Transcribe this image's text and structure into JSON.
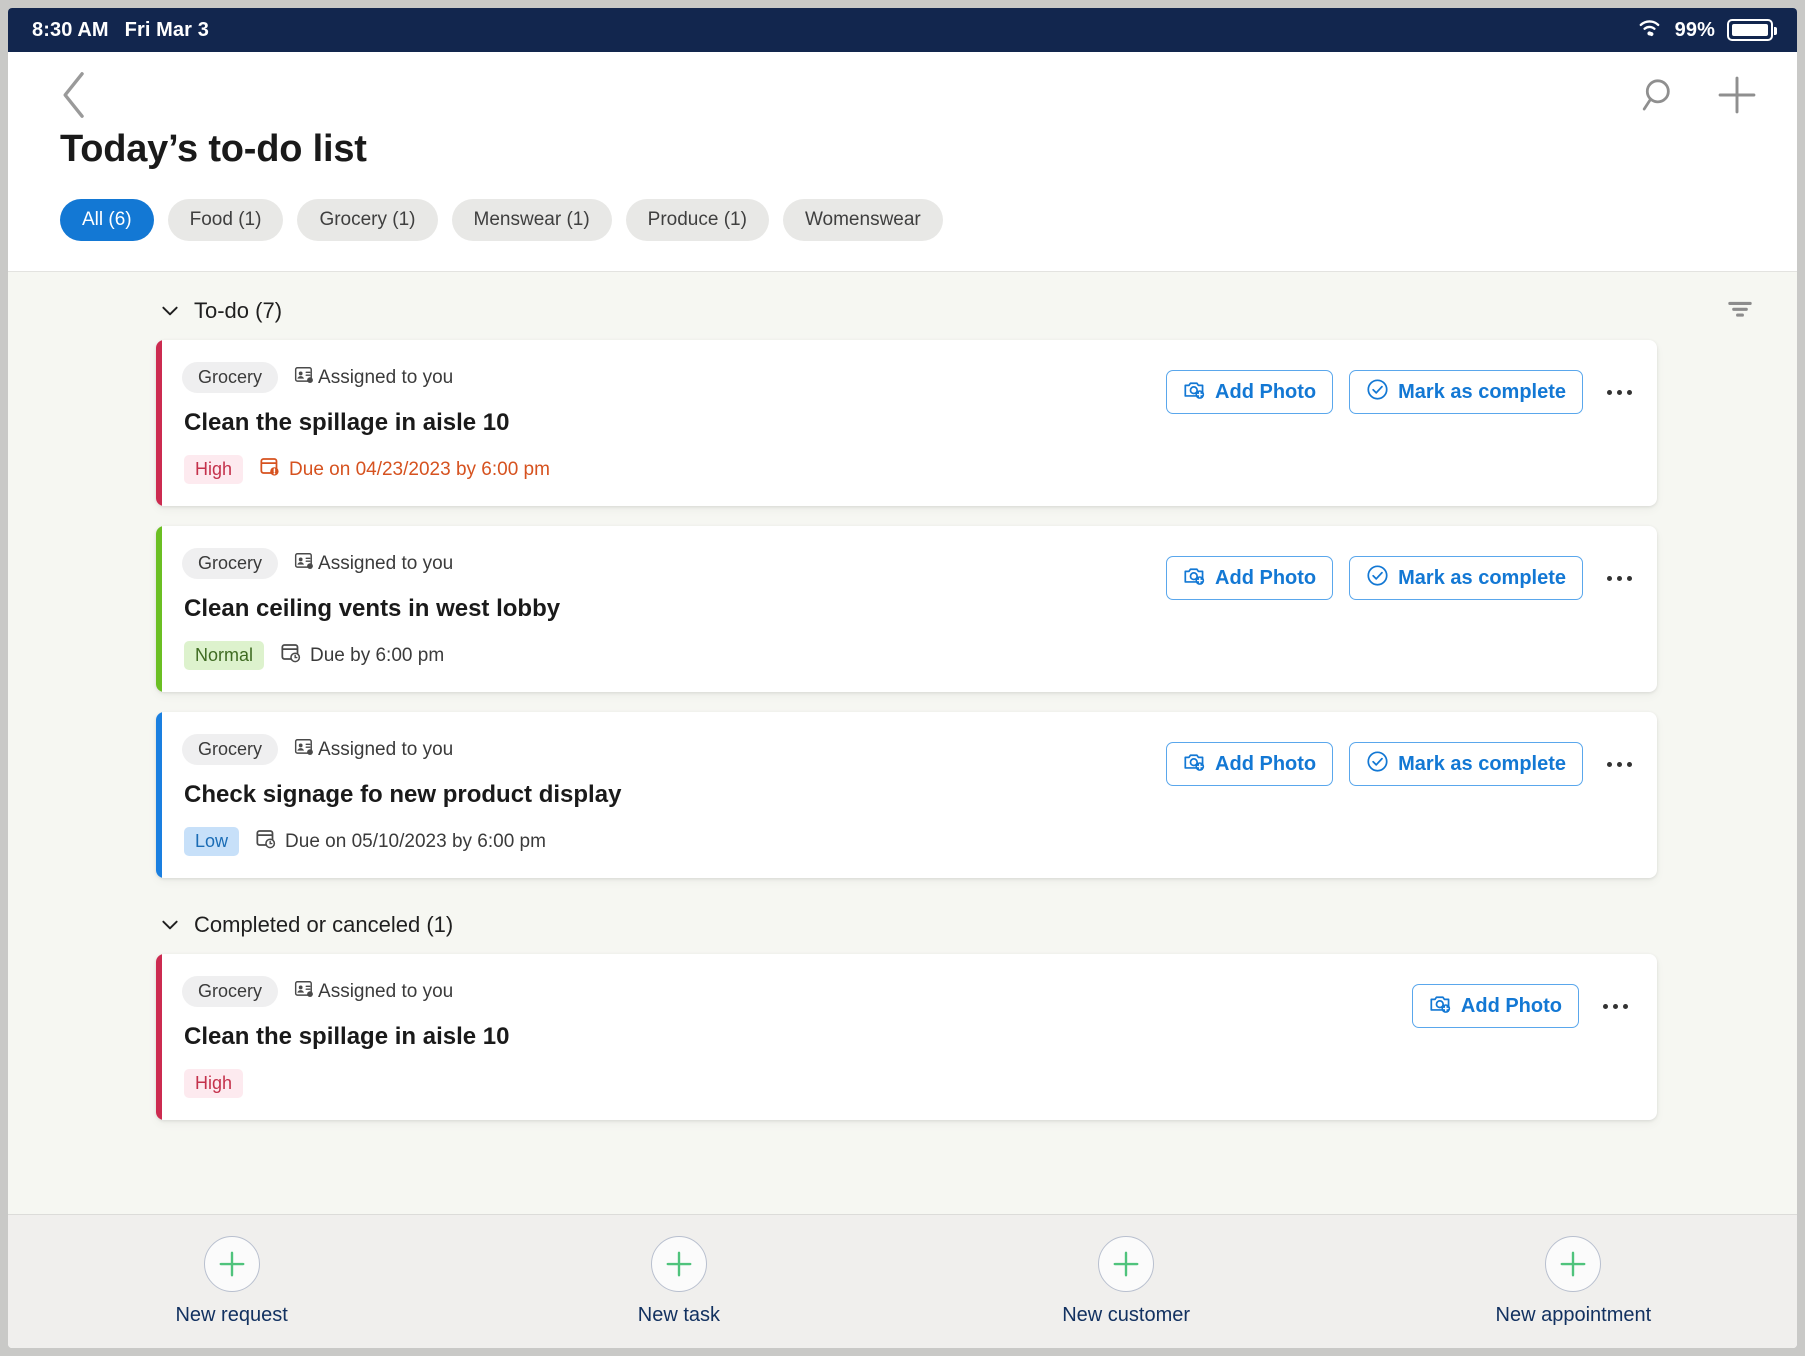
{
  "statusbar": {
    "time": "8:30 AM",
    "date": "Fri Mar 3",
    "battery_percent": "99%",
    "wifi_icon": "wifi-icon",
    "battery_icon": "battery-icon"
  },
  "header": {
    "back_icon": "chevron-left-icon",
    "search_icon": "search-icon",
    "add_icon": "plus-icon",
    "title": "Today’s to-do list"
  },
  "filters": {
    "chips": [
      {
        "label": "All (6)",
        "active": true
      },
      {
        "label": "Food (1)",
        "active": false
      },
      {
        "label": "Grocery (1)",
        "active": false
      },
      {
        "label": "Menswear (1)",
        "active": false
      },
      {
        "label": "Produce (1)",
        "active": false
      },
      {
        "label": "Womenswear",
        "active": false
      }
    ]
  },
  "sections": [
    {
      "title": "To-do (7)",
      "collapse_icon": "chevron-down-icon",
      "filter_icon": "filter-icon",
      "has_filter": true,
      "tasks": [
        {
          "stripe_color": "#cc2b50",
          "category": "Grocery",
          "assigned": "Assigned to you",
          "assigned_icon": "contact-card-icon",
          "title": "Clean the spillage in aisle 10",
          "priority": "High",
          "priority_class": "high",
          "due": "Due on 04/23/2023 by 6:00 pm",
          "due_overdue": true,
          "due_icon": "calendar-alert-icon",
          "actions": [
            {
              "label": "Add Photo",
              "icon": "camera-add-icon"
            },
            {
              "label": "Mark as complete",
              "icon": "check-circle-icon"
            }
          ],
          "more_icon": "more-horizontal-icon"
        },
        {
          "stripe_color": "#6bbf23",
          "category": "Grocery",
          "assigned": "Assigned to you",
          "assigned_icon": "contact-card-icon",
          "title": "Clean ceiling vents in west lobby",
          "priority": "Normal",
          "priority_class": "normal",
          "due": "Due by 6:00 pm",
          "due_overdue": false,
          "due_icon": "calendar-clock-icon",
          "actions": [
            {
              "label": "Add Photo",
              "icon": "camera-add-icon"
            },
            {
              "label": "Mark as complete",
              "icon": "check-circle-icon"
            }
          ],
          "more_icon": "more-horizontal-icon"
        },
        {
          "stripe_color": "#1a7fe0",
          "category": "Grocery",
          "assigned": "Assigned to you",
          "assigned_icon": "contact-card-icon",
          "title": "Check signage fo new product display",
          "priority": "Low",
          "priority_class": "low",
          "due": "Due on 05/10/2023 by 6:00 pm",
          "due_overdue": false,
          "due_icon": "calendar-clock-icon",
          "actions": [
            {
              "label": "Add Photo",
              "icon": "camera-add-icon"
            },
            {
              "label": "Mark as complete",
              "icon": "check-circle-icon"
            }
          ],
          "more_icon": "more-horizontal-icon"
        }
      ]
    },
    {
      "title": "Completed or canceled (1)",
      "collapse_icon": "chevron-down-icon",
      "has_filter": false,
      "tasks": [
        {
          "stripe_color": "#cc2b50",
          "category": "Grocery",
          "assigned": "Assigned to you",
          "assigned_icon": "contact-card-icon",
          "title": "Clean the spillage in aisle 10",
          "priority": "High",
          "priority_class": "high",
          "due": "",
          "due_overdue": false,
          "due_icon": "",
          "actions": [
            {
              "label": "Add Photo",
              "icon": "camera-add-icon"
            }
          ],
          "more_icon": "more-horizontal-icon"
        }
      ]
    }
  ],
  "bottombar": {
    "items": [
      {
        "label": "New request",
        "icon": "plus-circle-icon"
      },
      {
        "label": "New task",
        "icon": "plus-circle-icon"
      },
      {
        "label": "New customer",
        "icon": "plus-circle-icon"
      },
      {
        "label": "New appointment",
        "icon": "plus-circle-icon"
      }
    ]
  },
  "colors": {
    "statusbar_bg": "#12264e",
    "accent_blue": "#1378d4",
    "page_bg": "#f6f7f2",
    "overdue": "#d6521f",
    "plus_green": "#4fc37c"
  }
}
